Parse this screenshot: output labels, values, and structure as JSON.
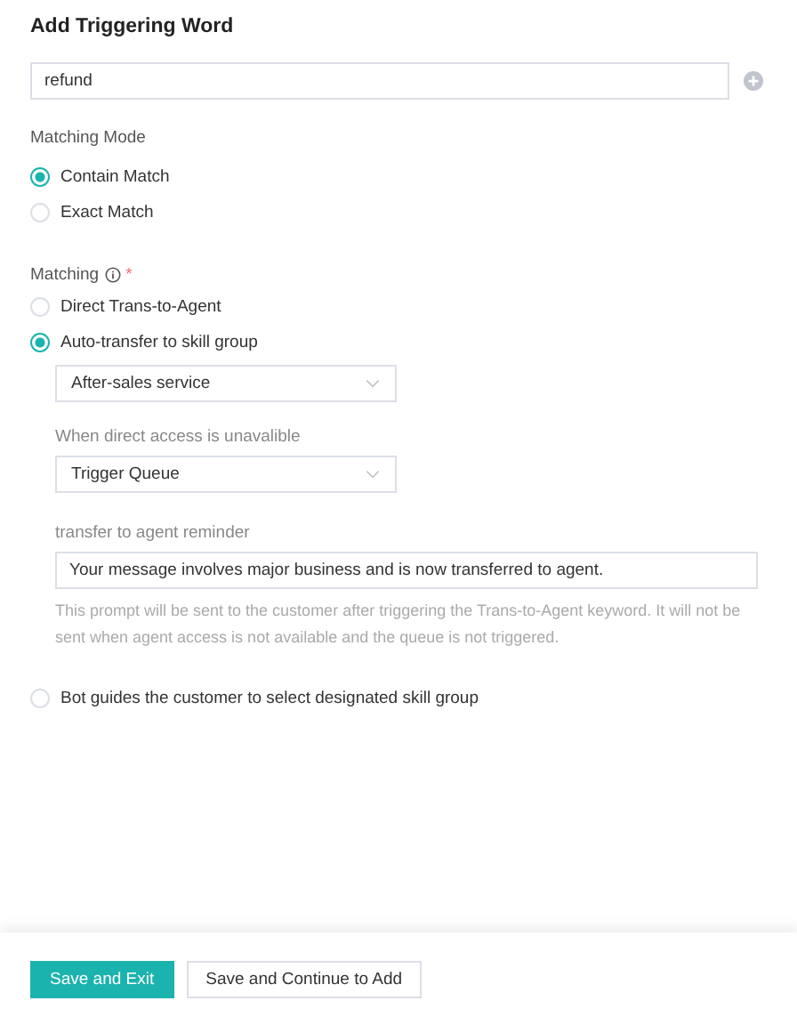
{
  "title": "Add Triggering Word",
  "trigger_word": {
    "value": "refund"
  },
  "matching_mode": {
    "label": "Matching Mode",
    "options": [
      {
        "label": "Contain Match",
        "selected": true
      },
      {
        "label": "Exact Match",
        "selected": false
      }
    ]
  },
  "matching": {
    "label": "Matching",
    "required_mark": "*",
    "options": [
      {
        "label": "Direct Trans-to-Agent",
        "selected": false
      },
      {
        "label": "Auto-transfer to skill group",
        "selected": true,
        "settings": {
          "skill_group": {
            "value": "After-sales service"
          },
          "fallback": {
            "label": "When direct access is unavalible",
            "value": "Trigger Queue"
          },
          "reminder": {
            "label": "transfer to agent reminder",
            "value": "Your message involves major business and is now transferred to agent.",
            "hint": "This prompt will be sent to the customer after triggering the Trans-to-Agent keyword. It will not be sent when agent access is not available and the queue is not triggered."
          }
        }
      },
      {
        "label": "Bot guides the customer to select designated skill group",
        "selected": false
      }
    ]
  },
  "buttons": [
    {
      "label": "Save and Exit",
      "kind": "primary"
    },
    {
      "label": "Save and Continue to Add",
      "kind": "default"
    }
  ]
}
